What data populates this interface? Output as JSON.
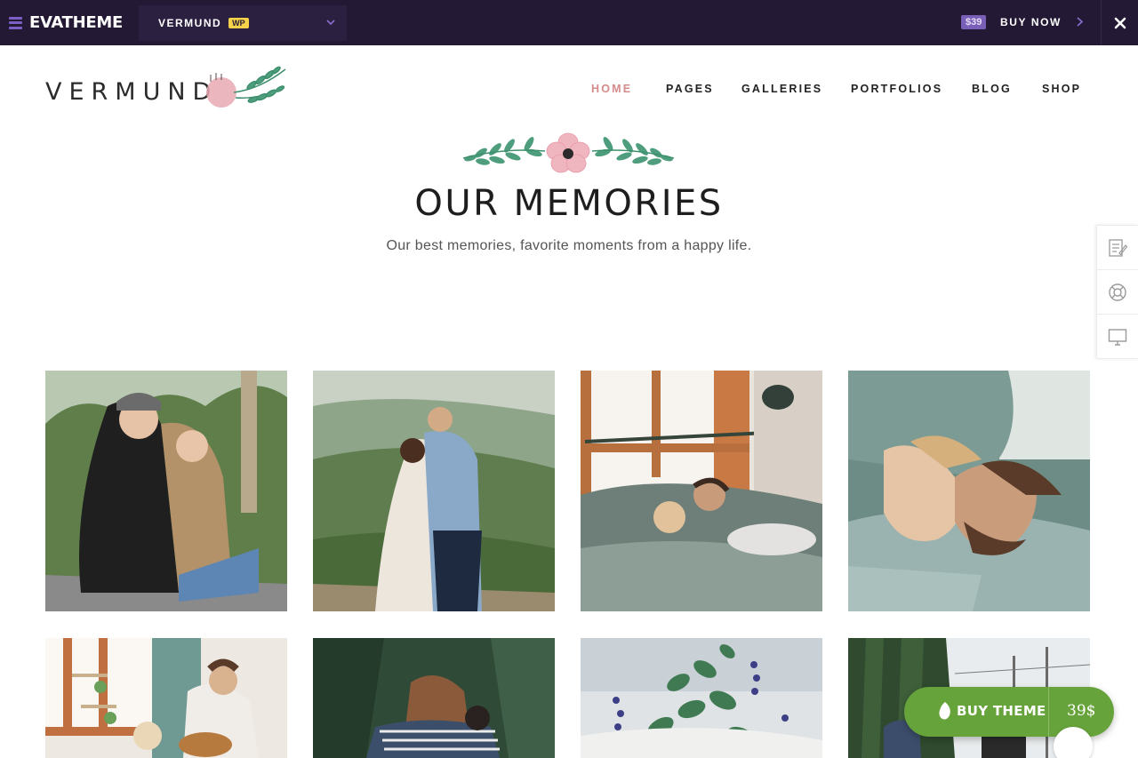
{
  "topbar": {
    "brand": "EVATHEME",
    "theme_name": "VERMUND",
    "theme_badge": "WP",
    "price": "$39",
    "buy_label": "BUY NOW",
    "icons": [
      "hamburger-icon",
      "chevron-down-icon",
      "chevron-right-icon",
      "close-icon"
    ]
  },
  "header": {
    "logo_text": "VERMUND",
    "nav": [
      {
        "label": "HOME",
        "active": true
      },
      {
        "label": "PAGES",
        "active": false
      },
      {
        "label": "GALLERIES",
        "active": false
      },
      {
        "label": "PORTFOLIOS",
        "active": false
      },
      {
        "label": "BLOG",
        "active": false
      },
      {
        "label": "SHOP",
        "active": false
      }
    ]
  },
  "hero": {
    "title": "OUR MEMORIES",
    "subtitle": "Our best memories, favorite moments from a happy life."
  },
  "side_tools": [
    "document-edit-icon",
    "lifebuoy-icon",
    "monitor-icon"
  ],
  "gallery": [
    {
      "name": "couple-sitting-outdoors-photo"
    },
    {
      "name": "couple-valley-view-photo"
    },
    {
      "name": "couple-in-bed-photo"
    },
    {
      "name": "couple-cuddling-photo"
    },
    {
      "name": "couple-guitar-photo"
    },
    {
      "name": "couple-forest-photo"
    },
    {
      "name": "plant-flowers-photo"
    },
    {
      "name": "couple-street-photo"
    }
  ],
  "float_buy": {
    "label": "BUY THEME",
    "price": "39$"
  },
  "colors": {
    "topbar_bg": "#241934",
    "accent_purple": "#7a5fb8",
    "nav_active": "#d48b8b",
    "buy_green": "#67a33b"
  }
}
